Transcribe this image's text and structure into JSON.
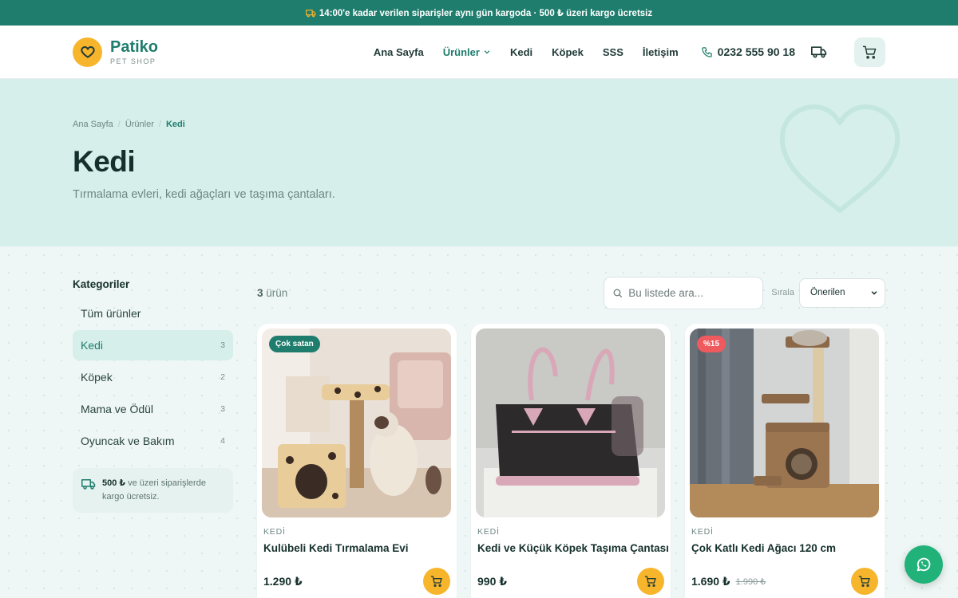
{
  "announcement": "14:00'e kadar verilen siparişler aynı gün kargoda · 500 ₺ üzeri kargo ücretsiz",
  "brand": {
    "name": "Patiko",
    "tagline": "PET SHOP"
  },
  "nav": {
    "items": [
      "Ana Sayfa",
      "Ürünler",
      "Kedi",
      "Köpek",
      "SSS",
      "İletişim"
    ],
    "phone": "0232 555 90 18"
  },
  "breadcrumb": [
    "Ana Sayfa",
    "Ürünler",
    "Kedi"
  ],
  "hero": {
    "title": "Kedi",
    "subtitle": "Tırmalama evleri, kedi ağaçları ve taşıma çantaları."
  },
  "sidebar": {
    "heading": "Kategoriler",
    "categories": [
      {
        "label": "Tüm ürünler",
        "count": ""
      },
      {
        "label": "Kedi",
        "count": "3"
      },
      {
        "label": "Köpek",
        "count": "2"
      },
      {
        "label": "Mama ve Ödül",
        "count": "3"
      },
      {
        "label": "Oyuncak ve Bakım",
        "count": "4"
      }
    ],
    "shipping_amount": "500 ₺",
    "shipping_text": " ve üzeri siparişlerde kargo ücretsiz."
  },
  "listing": {
    "count": "3",
    "count_suffix": " ürün",
    "search_placeholder": "Bu listede ara...",
    "sort_label": "Sırala",
    "sort_value": "Önerilen"
  },
  "products": [
    {
      "badge": "Çok satan",
      "category": "KEDİ",
      "title": "Kulübeli Kedi Tırmalama Evi",
      "price": "1.290 ₺",
      "old_price": ""
    },
    {
      "badge": "",
      "category": "KEDİ",
      "title": "Kedi ve Küçük Köpek Taşıma Çantası",
      "price": "990 ₺",
      "old_price": ""
    },
    {
      "badge": "%15",
      "category": "KEDİ",
      "title": "Çok Katlı Kedi Ağacı 120 cm",
      "price": "1.690 ₺",
      "old_price": "1.990 ₺"
    }
  ],
  "colors": {
    "primary": "#1f7d6d",
    "accent": "#f7b52c",
    "sale": "#ef5a5f",
    "whatsapp": "#21b27a"
  }
}
